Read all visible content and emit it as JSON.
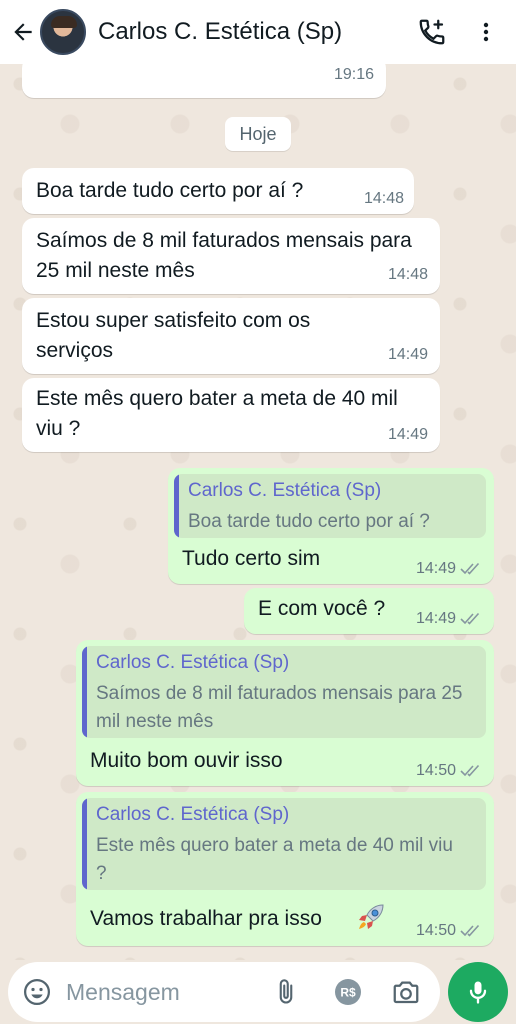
{
  "header": {
    "contact_name": "Carlos C. Estética (Sp)"
  },
  "chat": {
    "prev_time": "19:16",
    "day_label": "Hoje",
    "messages": [
      {
        "dir": "in",
        "text": "Boa tarde tudo certo por aí ?",
        "time": "14:48"
      },
      {
        "dir": "in",
        "text": "Saímos de 8 mil faturados mensais para 25 mil neste mês",
        "time": "14:48"
      },
      {
        "dir": "in",
        "text": "Estou super satisfeito com os serviços",
        "time": "14:49"
      },
      {
        "dir": "in",
        "text": "Este mês quero bater a meta de 40 mil viu ?",
        "time": "14:49"
      },
      {
        "dir": "out",
        "quote_name": "Carlos C. Estética (Sp)",
        "quote_text": "Boa tarde tudo certo por aí ?",
        "text": "Tudo certo sim",
        "time": "14:49",
        "status": "read"
      },
      {
        "dir": "out",
        "text": "E com você ?",
        "time": "14:49",
        "status": "read"
      },
      {
        "dir": "out",
        "quote_name": "Carlos C. Estética (Sp)",
        "quote_text": "Saímos de 8 mil faturados mensais para 25 mil neste mês",
        "text": "Muito bom ouvir isso",
        "time": "14:50",
        "status": "read"
      },
      {
        "dir": "out",
        "quote_name": "Carlos C. Estética (Sp)",
        "quote_text": "Este mês quero bater a meta de 40 mil viu ?",
        "text": "Vamos trabalhar pra isso",
        "emoji": "rocket-icon",
        "time": "14:50",
        "status": "read"
      }
    ]
  },
  "composer": {
    "placeholder": "Mensagem"
  },
  "colors": {
    "incoming_bubble": "#ffffff",
    "outgoing_bubble": "#d9fdd3",
    "quote_bar": "#5f66cd",
    "mic_button": "#1daa61",
    "chat_background": "#efe7de"
  }
}
